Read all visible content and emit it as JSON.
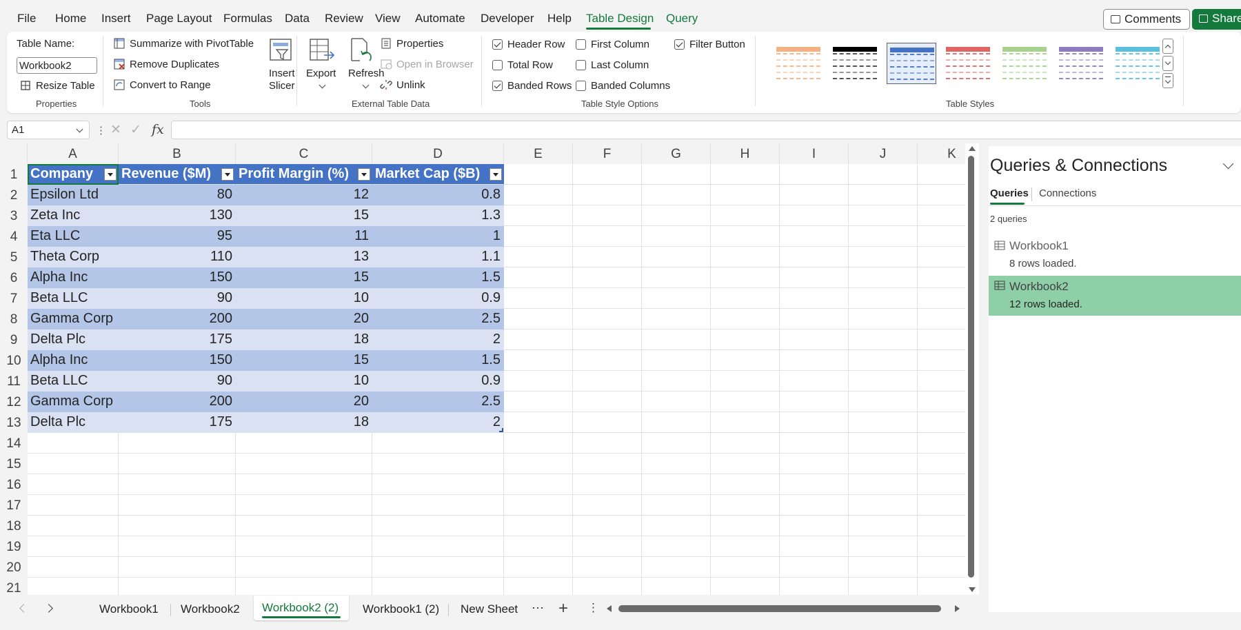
{
  "menu": {
    "items": [
      "File",
      "Home",
      "Insert",
      "Page Layout",
      "Formulas",
      "Data",
      "Review",
      "View",
      "Automate",
      "Developer",
      "Help",
      "Table Design",
      "Query"
    ],
    "active": "Table Design",
    "comments": "Comments",
    "share": "Share"
  },
  "ribbon": {
    "properties": {
      "table_name_label": "Table Name:",
      "table_name_value": "Workbook2",
      "resize_table": "Resize Table",
      "group": "Properties"
    },
    "tools": {
      "summarize": "Summarize with PivotTable",
      "remove_duplicates": "Remove Duplicates",
      "convert_to_range": "Convert to Range",
      "insert_slicer_1": "Insert",
      "insert_slicer_2": "Slicer",
      "group": "Tools"
    },
    "external": {
      "export": "Export",
      "refresh": "Refresh",
      "properties": "Properties",
      "open_in_browser": "Open in Browser",
      "unlink": "Unlink",
      "group": "External Table Data"
    },
    "style_options": {
      "header_row": "Header Row",
      "total_row": "Total Row",
      "banded_rows": "Banded Rows",
      "first_column": "First Column",
      "last_column": "Last Column",
      "banded_columns": "Banded Columns",
      "filter_button": "Filter Button",
      "group": "Table Style Options"
    },
    "styles": {
      "group": "Table Styles",
      "swatch_colors": [
        "#f4b183",
        "#000000",
        "#4472c4",
        "#e06666",
        "#a9d18e",
        "#8e7cc3",
        "#5bc0de"
      ]
    }
  },
  "formula_bar": {
    "name_box": "A1",
    "fx": "fx",
    "value": ""
  },
  "grid": {
    "columns": [
      "A",
      "B",
      "C",
      "D",
      "E",
      "F",
      "G",
      "H",
      "I",
      "J",
      "K"
    ],
    "rows": [
      "1",
      "2",
      "3",
      "4",
      "5",
      "6",
      "7",
      "8",
      "9",
      "10",
      "11",
      "12",
      "13",
      "14",
      "15",
      "16",
      "17",
      "18",
      "19",
      "20",
      "21"
    ],
    "table_headers": [
      "Company",
      "Revenue ($M)",
      "Profit Margin (%)",
      "Market Cap ($B)"
    ],
    "table_rows": [
      [
        "Epsilon Ltd",
        "80",
        "12",
        "0.8"
      ],
      [
        "Zeta Inc",
        "130",
        "15",
        "1.3"
      ],
      [
        "Eta LLC",
        "95",
        "11",
        "1"
      ],
      [
        "Theta Corp",
        "110",
        "13",
        "1.1"
      ],
      [
        "Alpha Inc",
        "150",
        "15",
        "1.5"
      ],
      [
        "Beta LLC",
        "90",
        "10",
        "0.9"
      ],
      [
        "Gamma Corp",
        "200",
        "20",
        "2.5"
      ],
      [
        "Delta Plc",
        "175",
        "18",
        "2"
      ],
      [
        "Alpha Inc",
        "150",
        "15",
        "1.5"
      ],
      [
        "Beta LLC",
        "90",
        "10",
        "0.9"
      ],
      [
        "Gamma Corp",
        "200",
        "20",
        "2.5"
      ],
      [
        "Delta Plc",
        "175",
        "18",
        "2"
      ]
    ]
  },
  "sheet_tabs": {
    "tabs": [
      "Workbook1",
      "Workbook2",
      "Workbook2 (2)",
      "Workbook1 (2)",
      "New Sheet"
    ],
    "active": "Workbook2 (2)"
  },
  "queries_pane": {
    "title": "Queries & Connections",
    "tab_queries": "Queries",
    "tab_connections": "Connections",
    "count": "2 queries",
    "items": [
      {
        "name": "Workbook1",
        "status": "8 rows loaded."
      },
      {
        "name": "Workbook2",
        "status": "12 rows loaded."
      }
    ]
  },
  "colors": {
    "accent": "#137a3c",
    "table_header": "#4472c4",
    "band_dark": "#b4c6e7",
    "band_light": "#d9e1f2",
    "selected_query": "#8fcfa8"
  }
}
